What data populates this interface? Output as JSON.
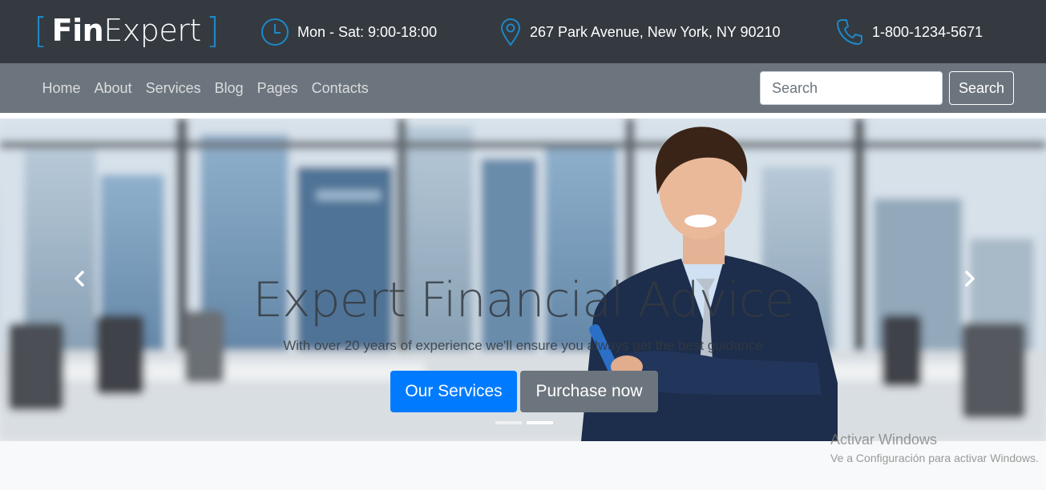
{
  "brand": {
    "bracket_left": "[",
    "fin": "Fin",
    "expert": "Expert",
    "bracket_right": "]",
    "accent_color": "#1e88c8"
  },
  "contact_info": {
    "hours": {
      "icon": "clock-icon",
      "text": "Mon - Sat: 9:00-18:00"
    },
    "address": {
      "icon": "map-pin-icon",
      "text": "267 Park Avenue, New York, NY 90210"
    },
    "phone": {
      "icon": "phone-icon",
      "text": "1-800-1234-5671"
    }
  },
  "nav": {
    "items": [
      {
        "label": "Home"
      },
      {
        "label": "About"
      },
      {
        "label": "Services"
      },
      {
        "label": "Blog"
      },
      {
        "label": "Pages"
      },
      {
        "label": "Contacts"
      }
    ]
  },
  "search": {
    "placeholder": "Search",
    "button_label": "Search"
  },
  "hero": {
    "title": "Expert Financial Advice",
    "subtitle": "With over 20 years of experience we'll ensure you always get the best guidance",
    "primary_button": "Our Services",
    "secondary_button": "Purchase now",
    "prev_icon": "chevron-left-icon",
    "next_icon": "chevron-right-icon",
    "slides_count": 2,
    "active_slide": 2
  },
  "watermark": {
    "line1": "Activar Windows",
    "line2": "Ve a Configuración para activar Windows."
  },
  "colors": {
    "topbar": "#343a40",
    "navbar": "#6c757d",
    "primary": "#007bff",
    "secondary": "#6c757d"
  }
}
